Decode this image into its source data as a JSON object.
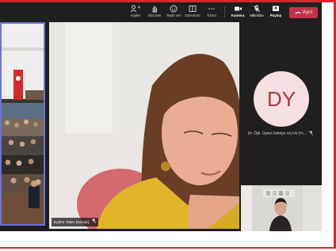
{
  "colors": {
    "window_frame": "#d9262b",
    "meeting_bg": "#1f1f1f",
    "leave_button": "#c4314b",
    "active_speaker_border": "#6b73d8",
    "avatar_bg": "#f6dfe0",
    "avatar_text": "#a33a3e"
  },
  "toolbar": {
    "people": {
      "label": "Kişiler",
      "count": "4",
      "icon": "people-icon"
    },
    "raise_hand": {
      "label": "Söz iste",
      "icon": "hand-icon"
    },
    "react": {
      "label": "Tepki ver",
      "icon": "smiley-icon"
    },
    "view": {
      "label": "Görünüm",
      "icon": "layout-icon"
    },
    "more": {
      "label": "Tümü",
      "icon": "more-icon"
    },
    "camera": {
      "label": "Kamera",
      "icon": "camera-icon"
    },
    "mic": {
      "label": "Mikrofon",
      "icon": "mic-muted-icon"
    },
    "share": {
      "label": "Paylaş",
      "icon": "share-icon"
    },
    "leave": {
      "label": "Ayrıl",
      "icon": "phone-hangup-icon"
    }
  },
  "participants": {
    "main": {
      "name": "Eylem Toker (Konuk)",
      "muted": true
    },
    "avatar": {
      "initials": "DY",
      "name": "Dr. Öğr. Üyesi Sabriye UÇAN (Yı...",
      "muted": true
    }
  }
}
